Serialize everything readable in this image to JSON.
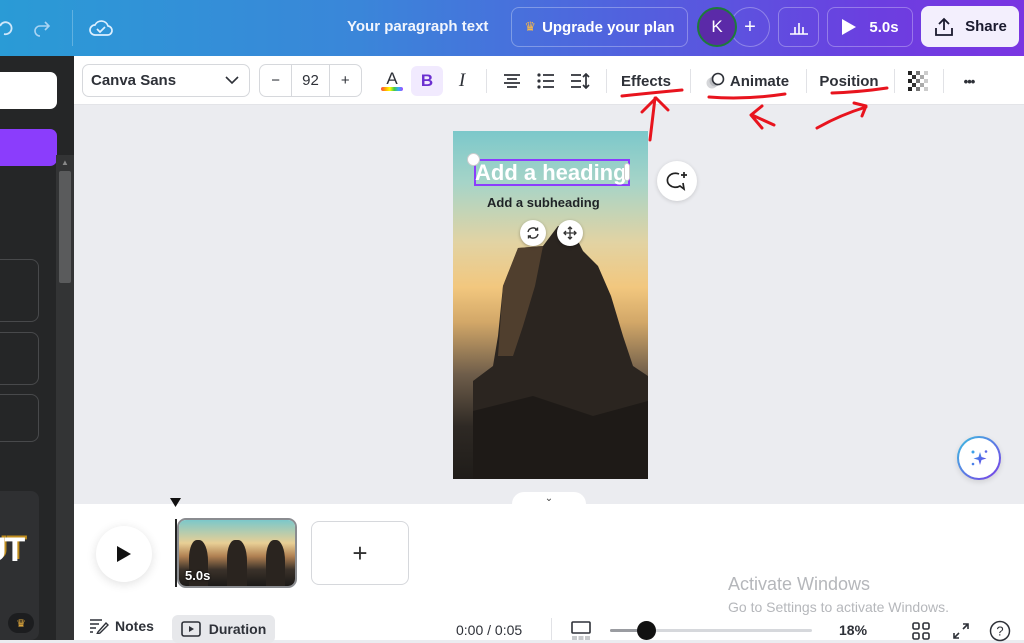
{
  "topbar": {
    "undo_icon": "undo-icon",
    "redo_icon": "redo-icon",
    "saved_icon": "cloud-check-icon",
    "document_title": "Your paragraph text",
    "upgrade_label": "Upgrade your plan",
    "avatar_initial": "K",
    "invite_label": "+",
    "play_duration": "5.0s",
    "share_label": "Share"
  },
  "toolbar": {
    "font_family": "Canva Sans",
    "font_size": "92",
    "size_minus": "−",
    "size_plus": "+",
    "text_color_glyph": "A",
    "bold_glyph": "B",
    "italic_glyph": "I",
    "effects_label": "Effects",
    "animate_label": "Animate",
    "position_label": "Position",
    "more_label": "•••"
  },
  "canvas": {
    "heading": "Add a heading",
    "subheading": "Add a subheading"
  },
  "sidebar": {
    "promo_text": "UT"
  },
  "timeline": {
    "clip_duration": "5.0s",
    "add_page_label": "+",
    "notes_label": "Notes",
    "duration_label": "Duration",
    "time_readout": "0:00 / 0:05",
    "zoom_level": "18%",
    "zoom_fraction": 0.18
  },
  "watermark": {
    "line1": "Activate Windows",
    "line2": "Go to Settings to activate Windows."
  },
  "colors": {
    "accent_purple": "#8b3dfc",
    "annotation_red": "#e8141e",
    "selection": "#8b3dfc"
  }
}
